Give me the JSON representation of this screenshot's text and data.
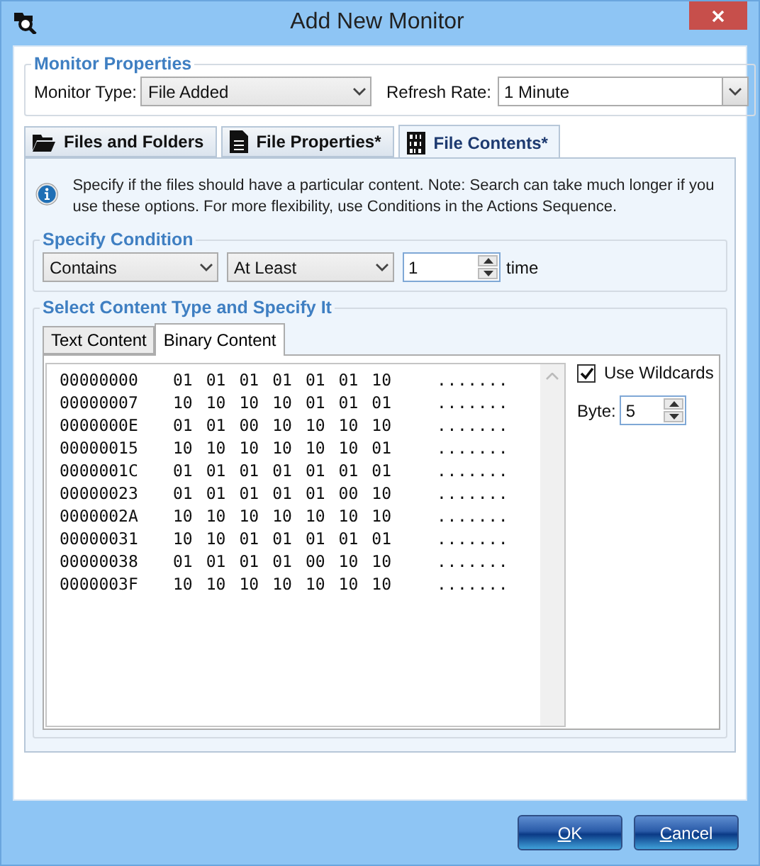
{
  "window": {
    "title": "Add New Monitor"
  },
  "monitor_properties": {
    "legend": "Monitor Properties",
    "monitor_type_label": "Monitor Type:",
    "monitor_type": "File Added",
    "refresh_rate_label": "Refresh Rate:",
    "refresh_rate": "1 Minute"
  },
  "tabs": [
    {
      "label": "Files and Folders",
      "kind": "folder",
      "selected": false
    },
    {
      "label": "File Properties*",
      "kind": "document",
      "selected": false
    },
    {
      "label": "File Contents*",
      "kind": "binary",
      "selected": true
    }
  ],
  "info_text": "Specify if the files should have a particular content. Note: Search can take much longer if you use these options. For more flexibility, use Conditions in the Actions Sequence.",
  "condition": {
    "legend": "Specify Condition",
    "match": "Contains",
    "quantifier": "At Least",
    "count": "1",
    "unit": "time"
  },
  "content": {
    "legend": "Select Content Type and Specify It",
    "tabs": [
      {
        "label": "Text Content",
        "selected": false
      },
      {
        "label": "Binary Content",
        "selected": true
      }
    ],
    "rows": [
      {
        "address": "00000000",
        "bytes": [
          "01",
          "01",
          "01",
          "01",
          "01",
          "01",
          "10"
        ],
        "ascii": "......."
      },
      {
        "address": "00000007",
        "bytes": [
          "10",
          "10",
          "10",
          "10",
          "01",
          "01",
          "01"
        ],
        "ascii": "......."
      },
      {
        "address": "0000000E",
        "bytes": [
          "01",
          "01",
          "00",
          "10",
          "10",
          "10",
          "10"
        ],
        "ascii": "......."
      },
      {
        "address": "00000015",
        "bytes": [
          "10",
          "10",
          "10",
          "10",
          "10",
          "10",
          "01"
        ],
        "ascii": "......."
      },
      {
        "address": "0000001C",
        "bytes": [
          "01",
          "01",
          "01",
          "01",
          "01",
          "01",
          "01"
        ],
        "ascii": "......."
      },
      {
        "address": "00000023",
        "bytes": [
          "01",
          "01",
          "01",
          "01",
          "01",
          "00",
          "10"
        ],
        "ascii": "......."
      },
      {
        "address": "0000002A",
        "bytes": [
          "10",
          "10",
          "10",
          "10",
          "10",
          "10",
          "10"
        ],
        "ascii": "......."
      },
      {
        "address": "00000031",
        "bytes": [
          "10",
          "10",
          "01",
          "01",
          "01",
          "01",
          "01"
        ],
        "ascii": "......."
      },
      {
        "address": "00000038",
        "bytes": [
          "01",
          "01",
          "01",
          "01",
          "00",
          "10",
          "10"
        ],
        "ascii": "......."
      },
      {
        "address": "0000003F",
        "bytes": [
          "10",
          "10",
          "10",
          "10",
          "10",
          "10",
          "10"
        ],
        "ascii": "......."
      }
    ],
    "use_wildcards": {
      "label": "Use Wildcards",
      "checked": true
    },
    "byte_label": "Byte:",
    "byte_value": "5"
  },
  "buttons": [
    {
      "label": "OK"
    },
    {
      "label": "Cancel"
    }
  ]
}
